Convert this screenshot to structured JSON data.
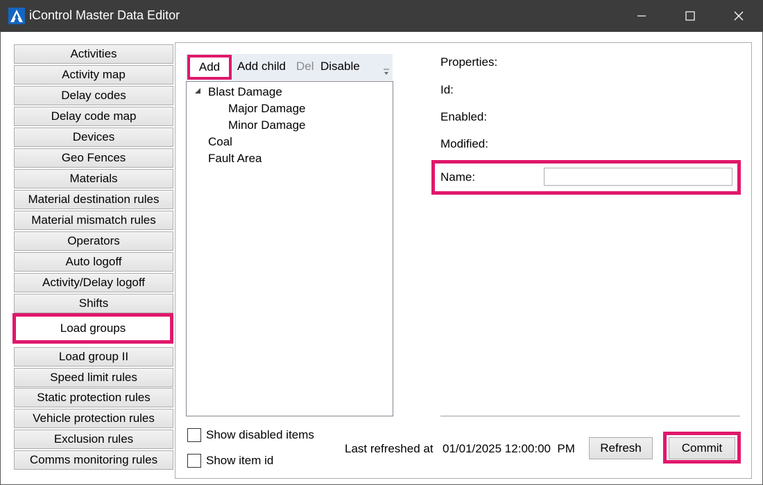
{
  "window": {
    "title": "iControl Master Data Editor",
    "accent_color": "#e0186b",
    "titlebar_color": "#3c3c3c",
    "controls": [
      "minimize-icon",
      "maximize-icon",
      "close-icon"
    ]
  },
  "sidebar": {
    "items": [
      {
        "label": "Activities"
      },
      {
        "label": "Activity map"
      },
      {
        "label": "Delay codes"
      },
      {
        "label": "Delay code map"
      },
      {
        "label": "Devices"
      },
      {
        "label": "Geo Fences"
      },
      {
        "label": "Materials"
      },
      {
        "label": "Material destination rules"
      },
      {
        "label": "Material mismatch rules"
      },
      {
        "label": "Operators"
      },
      {
        "label": "Auto logoff"
      },
      {
        "label": "Activity/Delay logoff"
      },
      {
        "label": "Shifts"
      },
      {
        "label": "Load groups",
        "selected": true
      },
      {
        "label": "Load group II"
      },
      {
        "label": "Speed limit rules"
      },
      {
        "label": "Static protection rules"
      },
      {
        "label": "Vehicle protection rules"
      },
      {
        "label": "Exclusion rules"
      },
      {
        "label": "Comms monitoring rules"
      }
    ]
  },
  "toolbar": {
    "add_label": "Add",
    "add_child_label": "Add child",
    "del_label": "Del",
    "disable_label": "Disable",
    "overflow_icon": "chevron-down-icon"
  },
  "tree": {
    "items": [
      {
        "label": "Blast Damage",
        "expanded": true,
        "children": [
          {
            "label": "Major Damage"
          },
          {
            "label": "Minor Damage"
          }
        ]
      },
      {
        "label": "Coal"
      },
      {
        "label": "Fault Area"
      }
    ]
  },
  "options": {
    "show_disabled_label": "Show disabled items",
    "show_disabled_checked": false,
    "show_id_label": "Show item id",
    "show_id_checked": false
  },
  "properties": {
    "header": "Properties:",
    "id_label": "Id:",
    "enabled_label": "Enabled:",
    "modified_label": "Modified:",
    "name_label": "Name:",
    "name_value": ""
  },
  "status": {
    "last_refreshed_label": "Last refreshed at",
    "last_refreshed_value": "01/01/2025 12:00:00  PM"
  },
  "buttons": {
    "refresh_label": "Refresh",
    "commit_label": "Commit"
  }
}
